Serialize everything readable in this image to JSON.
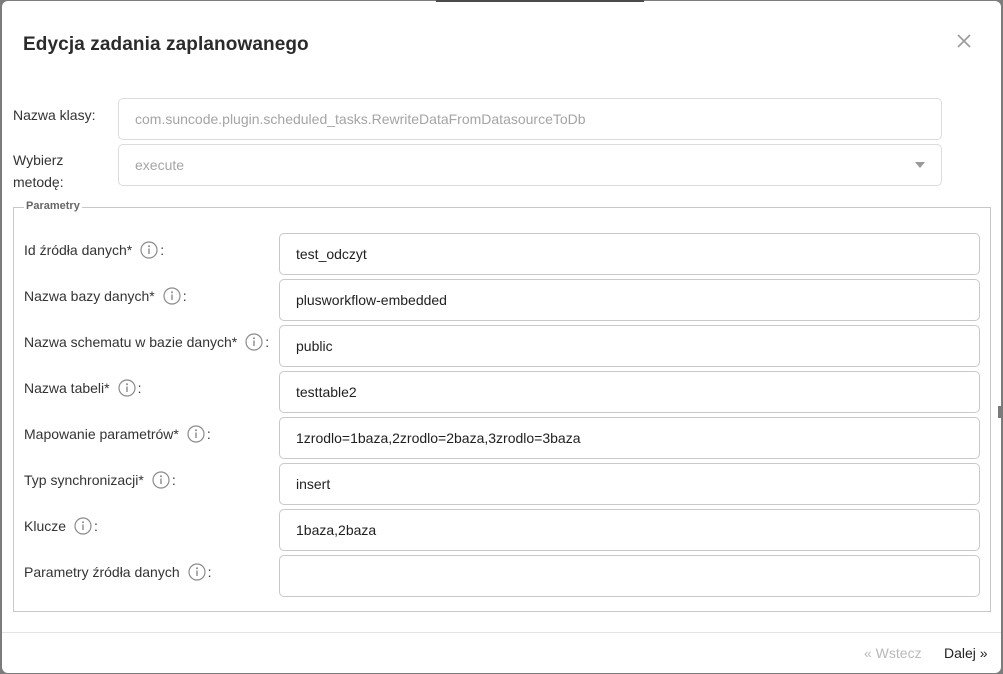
{
  "modal": {
    "title": "Edycja zadania zaplanowanego"
  },
  "form": {
    "class_label": "Nazwa klasy:",
    "class_value": "com.suncode.plugin.scheduled_tasks.RewriteDataFromDatasourceToDb",
    "method_label_line1": "Wybierz",
    "method_label_line2": "metodę:",
    "method_value": "execute"
  },
  "parameters": {
    "legend": "Parametry",
    "items": [
      {
        "label": "Id źródła danych*",
        "suffix": ":",
        "value": "test_odczyt"
      },
      {
        "label": "Nazwa bazy danych*",
        "suffix": ":",
        "value": "plusworkflow-embedded"
      },
      {
        "label": "Nazwa schematu w bazie danych*",
        "suffix": ":",
        "value": "public"
      },
      {
        "label": "Nazwa tabeli*",
        "suffix": ":",
        "value": "testtable2"
      },
      {
        "label": "Mapowanie parametrów*",
        "suffix": ":",
        "value": "1zrodlo=1baza,2zrodlo=2baza,3zrodlo=3baza"
      },
      {
        "label": "Typ synchronizacji*",
        "suffix": ":",
        "value": "insert"
      },
      {
        "label": "Klucze",
        "suffix": ":",
        "value": "1baza,2baza"
      },
      {
        "label": "Parametry źródła danych",
        "suffix": ":",
        "value": ""
      }
    ]
  },
  "footer": {
    "prev_label": "« Wstecz",
    "next_label": "Dalej »"
  },
  "icons": {
    "close": "close-icon",
    "info": "info-icon",
    "select_caret": "chevron-down-icon"
  },
  "colors": {
    "backdrop": "#7c7c7c",
    "input_border": "#c9c9c9",
    "readonly_text": "#a4a4a4",
    "disabled_button": "#b9b9b9"
  }
}
